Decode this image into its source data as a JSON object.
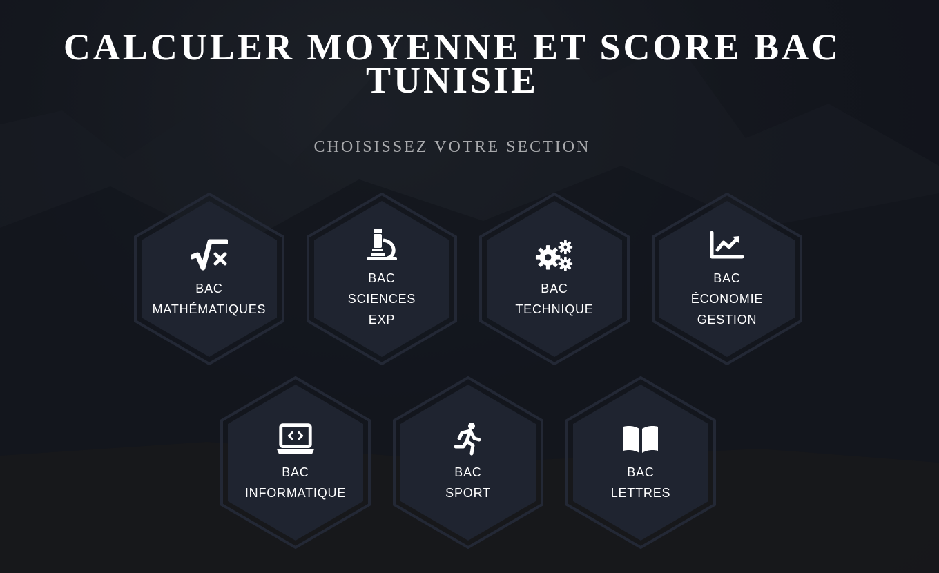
{
  "page": {
    "title": "CALCULER MOYENNE ET SCORE BAC TUNISIE",
    "subtitle": "CHOISISSEZ VOTRE SECTION"
  },
  "colors": {
    "background": "#12151d",
    "hex_fill": "#1f2430",
    "hex_border": "#252a36",
    "text": "#ffffff",
    "subtitle": "#a9aaad"
  },
  "sections": [
    {
      "icon": "square-root-icon",
      "label_line1": "BAC",
      "label_line2": "MATHÉMATIQUES",
      "label_line3": ""
    },
    {
      "icon": "microscope-icon",
      "label_line1": "BAC",
      "label_line2": "SCIENCES",
      "label_line3": "EXP"
    },
    {
      "icon": "gears-icon",
      "label_line1": "BAC",
      "label_line2": "TECHNIQUE",
      "label_line3": ""
    },
    {
      "icon": "chart-line-icon",
      "label_line1": "BAC",
      "label_line2": "ÉCONOMIE",
      "label_line3": "GESTION"
    },
    {
      "icon": "laptop-code-icon",
      "label_line1": "BAC",
      "label_line2": "INFORMATIQUE",
      "label_line3": ""
    },
    {
      "icon": "running-icon",
      "label_line1": "BAC",
      "label_line2": "SPORT",
      "label_line3": ""
    },
    {
      "icon": "book-open-icon",
      "label_line1": "BAC",
      "label_line2": "LETTRES",
      "label_line3": ""
    }
  ]
}
